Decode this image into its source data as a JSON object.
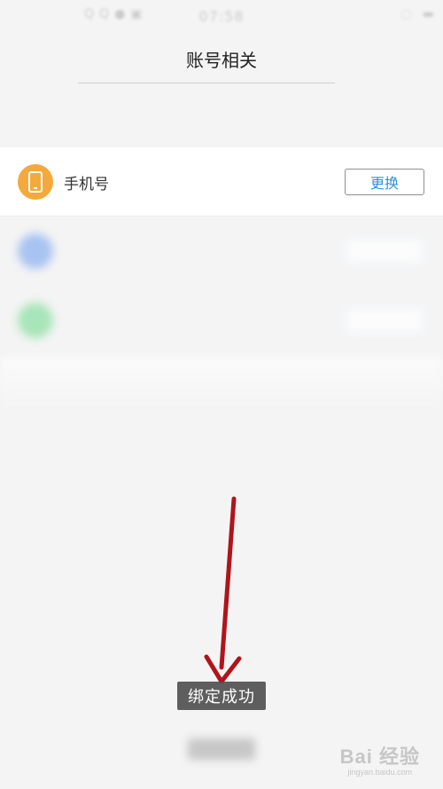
{
  "status_bar": {
    "time": "07:58",
    "left_icons": [
      "qq-icon",
      "qq-icon",
      "message-icon",
      "sim-icon"
    ],
    "right_icons": [
      "sync-icon",
      "battery-icon"
    ]
  },
  "header": {
    "title": "账号相关"
  },
  "tip_text": "",
  "accounts": [
    {
      "label": "手机号",
      "value": "",
      "action": "更换",
      "icon": "phone-icon",
      "icon_color": "#f4a93c"
    },
    {
      "label": "",
      "value": "",
      "action": "",
      "icon": "qq-icon",
      "icon_color": "#8fb3f0"
    },
    {
      "label": "",
      "value": "",
      "action": "",
      "icon": "wechat-icon",
      "icon_color": "#8fe0a5"
    }
  ],
  "toast": {
    "text": "绑定成功"
  },
  "annotation": {
    "arrow_color": "#b0141b"
  },
  "watermark": {
    "brand": "Bai 经验",
    "sub": "jingyan.baidu.com"
  }
}
